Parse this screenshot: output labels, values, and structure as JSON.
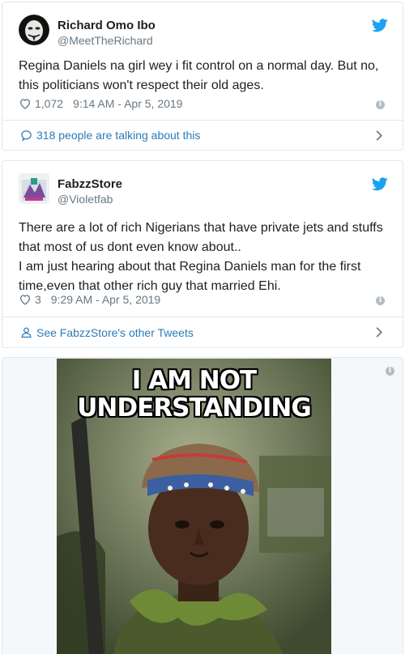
{
  "tweets": [
    {
      "author_name": "Richard Omo Ibo",
      "handle": "@MeetTheRichard",
      "text": "Regina Daniels na girl wey i fit control on a normal day. But no, this politicians won't respect their old ages.",
      "likes": "1,072",
      "timestamp": "9:14 AM - Apr 5, 2019",
      "footer_text": "318 people are talking about this",
      "footer_icon": "comment-icon"
    },
    {
      "author_name": "FabzzStore",
      "handle": "@Violetfab",
      "text_lines": [
        "There are a lot of rich Nigerians that have private jets and stuffs that most of us dont even know about..",
        "I am just hearing about that Regina Daniels man for the first time,even that other rich guy that married Ehi."
      ],
      "likes": "3",
      "timestamp": "9:29 AM - Apr 5, 2019",
      "footer_text": "See FabzzStore's other Tweets",
      "footer_icon": "person-icon"
    }
  ],
  "media": {
    "caption_line1": "I AM NOT",
    "caption_line2": "UNDERSTANDING"
  },
  "colors": {
    "twitter_blue": "#1da1f2",
    "link_blue": "#2b7bb9",
    "muted_gray": "#697882",
    "border": "#e1e8ed"
  }
}
